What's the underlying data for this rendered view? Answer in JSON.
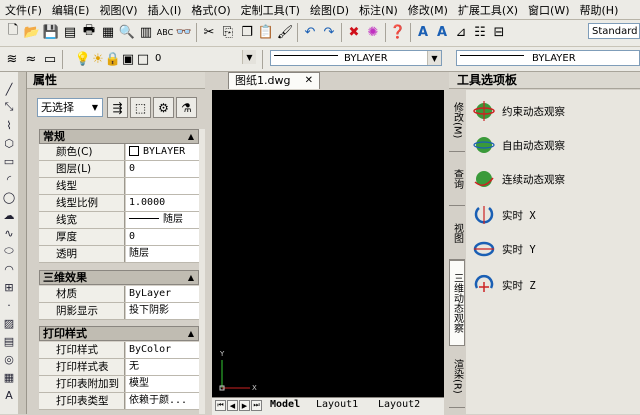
{
  "menu": [
    "文件(F)",
    "编辑(E)",
    "视图(V)",
    "插入(I)",
    "格式(O)",
    "定制工具(T)",
    "绘图(D)",
    "标注(N)",
    "修改(M)",
    "扩展工具(X)",
    "窗口(W)",
    "帮助(H)"
  ],
  "toolbar": {
    "style_combo": "Standard",
    "layer_combo": "0",
    "color_combo": "BYLAYER",
    "linetype_combo": "BYLAYER"
  },
  "properties": {
    "title": "属性",
    "selection": "无选择",
    "sections": [
      {
        "name": "常规",
        "rows": [
          {
            "k": "颜色(C)",
            "v": "BYLAYER"
          },
          {
            "k": "图层(L)",
            "v": "0"
          },
          {
            "k": "线型",
            "v": ""
          },
          {
            "k": "线型比例",
            "v": "1.0000"
          },
          {
            "k": "线宽",
            "v": "随层"
          },
          {
            "k": "厚度",
            "v": "0"
          },
          {
            "k": "透明",
            "v": "随层"
          }
        ]
      },
      {
        "name": "三维效果",
        "rows": [
          {
            "k": "材质",
            "v": "ByLayer"
          },
          {
            "k": "阴影显示",
            "v": "投下阴影"
          }
        ]
      },
      {
        "name": "打印样式",
        "rows": [
          {
            "k": "打印样式",
            "v": "ByColor"
          },
          {
            "k": "打印样式表",
            "v": "无"
          },
          {
            "k": "打印表附加到",
            "v": "模型"
          },
          {
            "k": "打印表类型",
            "v": "依赖于颜..."
          }
        ]
      }
    ]
  },
  "document": {
    "tab": "图纸1.dwg",
    "layout_tabs": [
      "Model",
      "Layout1",
      "Layout2"
    ],
    "ucs_x": "X",
    "ucs_y": "Y"
  },
  "palette": {
    "title": "工具选项板",
    "side_tabs": [
      "修改(M)",
      "查询",
      "视图",
      "三维动态观察",
      "渲染(R)"
    ],
    "tools": [
      "约束动态观察",
      "自由动态观察",
      "连续动态观察",
      "实时 X",
      "实时 Y",
      "实时 Z"
    ]
  },
  "colors": {
    "accent": "#1a5fb4",
    "orbit_green": "#3a9a3a",
    "canvas": "#000000"
  }
}
